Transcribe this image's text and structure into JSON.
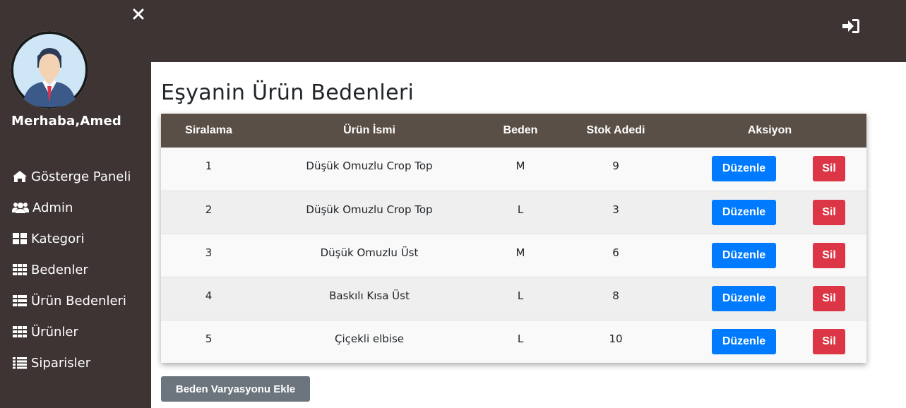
{
  "sidebar": {
    "greeting": "Merhaba,Amed",
    "items": [
      {
        "label": "Gösterge Paneli",
        "icon": "home-icon"
      },
      {
        "label": "Admin",
        "icon": "users-icon"
      },
      {
        "label": "Kategori",
        "icon": "grid-icon"
      },
      {
        "label": "Bedenler",
        "icon": "grid-9-icon"
      },
      {
        "label": "Ürün Bedenleri",
        "icon": "table-list-icon"
      },
      {
        "label": "Ürünler",
        "icon": "grid-9-icon"
      },
      {
        "label": "Siparisler",
        "icon": "list-icon"
      }
    ]
  },
  "main": {
    "title": "Eşyanin Ürün Bedenleri",
    "add_button": "Beden Varyasyonu Ekle"
  },
  "table": {
    "headers": [
      "Siralama",
      "Ürün İsmi",
      "Beden",
      "Stok Adedi",
      "Aksiyon"
    ],
    "rows": [
      [
        "1",
        "Düşük Omuzlu Crop Top",
        "M",
        "9"
      ],
      [
        "2",
        "Düşük Omuzlu Crop Top",
        "L",
        "3"
      ],
      [
        "3",
        "Düşük Omuzlu Üst",
        "M",
        "6"
      ],
      [
        "4",
        "Baskılı Kısa Üst",
        "L",
        "8"
      ],
      [
        "5",
        "Çiçekli elbise",
        "L",
        "10"
      ]
    ],
    "edit_label": "Düzenle",
    "delete_label": "Sil"
  },
  "colors": {
    "sidebar_bg": "#3e3433",
    "table_header_bg": "#5a4f46",
    "edit_button": "#007bff",
    "delete_button": "#dc3545",
    "secondary_button": "#6c757d"
  }
}
